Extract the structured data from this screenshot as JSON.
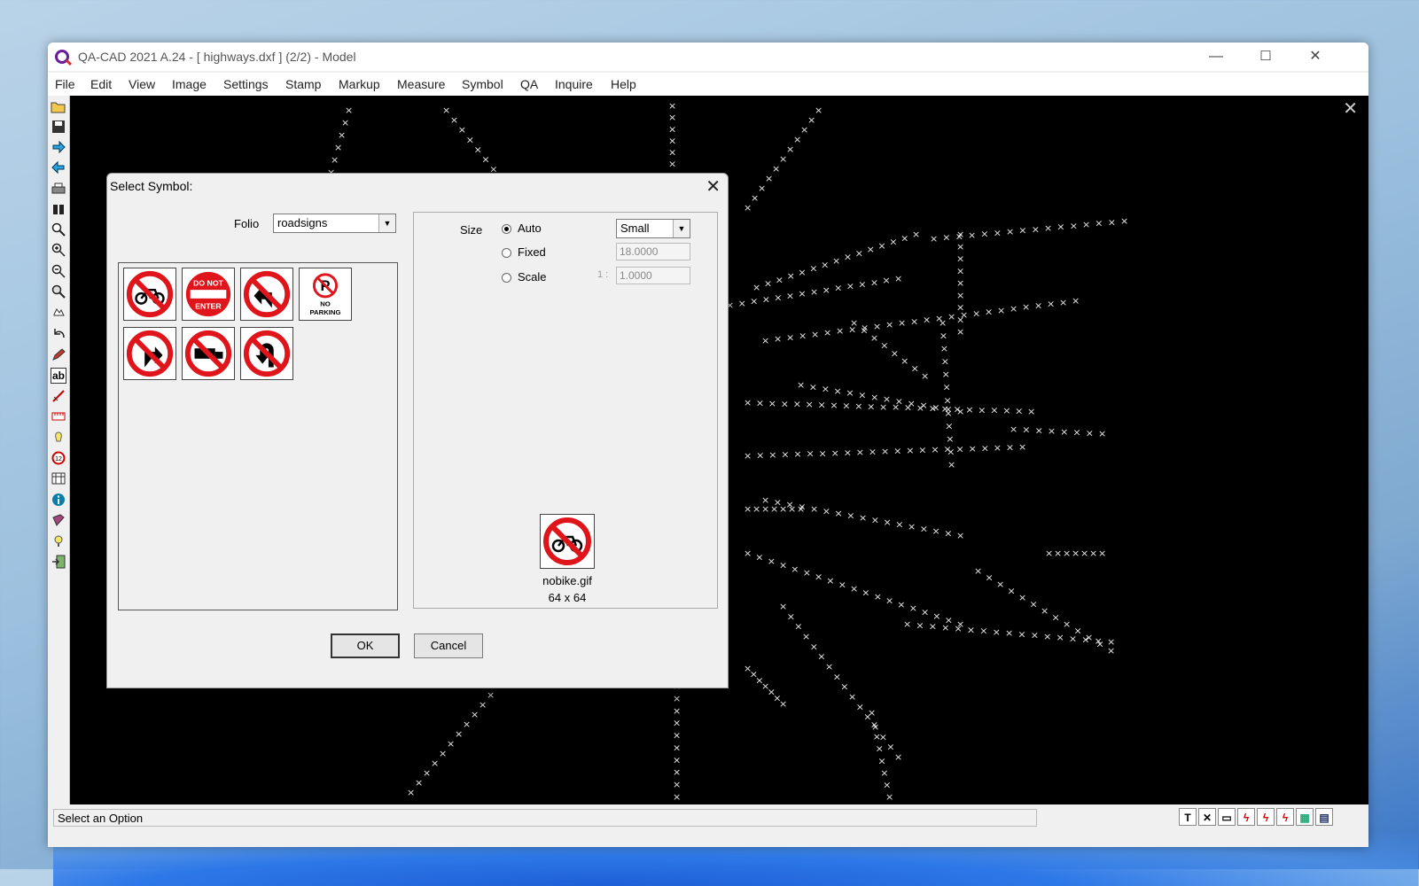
{
  "window": {
    "title": "QA-CAD 2021 A.24  -  [ highways.dxf ] (2/2)  -  Model",
    "minimize": "—",
    "maximize": "☐",
    "close": "✕"
  },
  "menu": [
    "File",
    "Edit",
    "View",
    "Image",
    "Settings",
    "Stamp",
    "Markup",
    "Measure",
    "Symbol",
    "QA",
    "Inquire",
    "Help"
  ],
  "toolbar_icons": [
    "open-icon",
    "save-icon",
    "forward-icon",
    "back-icon",
    "print-icon",
    "binoculars-icon",
    "zoom-icon",
    "zoom-in-icon",
    "zoom-out-icon",
    "zoom-window-icon",
    "pan-icon",
    "undo-icon",
    "pencil-icon",
    "text-icon",
    "measure-icon",
    "ruler-icon",
    "bulb-icon",
    "numbered-stamp-icon",
    "columns-icon",
    "info-icon",
    "book-icon",
    "help-icon",
    "exit-icon"
  ],
  "status": {
    "text": "Select an Option",
    "icons": [
      "T",
      "✕",
      "▭",
      "ϟ",
      "ϟ",
      "ϟ",
      "▦",
      "▤"
    ]
  },
  "dialog": {
    "title": "Select Symbol:",
    "close": "✕",
    "folio_label": "Folio",
    "folio_value": "roadsigns",
    "symbols": [
      "no-bike-sign",
      "do-not-enter-sign",
      "no-left-turn-sign",
      "no-parking-sign",
      "no-right-turn-sign",
      "no-trucks-sign",
      "no-u-turn-sign"
    ],
    "do_not_enter_text": [
      "DO NOT",
      "ENTER"
    ],
    "no_parking_text": [
      "P",
      "NO",
      "PARKING"
    ],
    "size_label": "Size",
    "options": {
      "auto": "Auto",
      "fixed": "Fixed",
      "scale": "Scale",
      "selected": "auto"
    },
    "size_select": "Small",
    "fixed_value": "18.0000",
    "scale_prefix": "1 :",
    "scale_value": "1.0000",
    "preview_name": "nobike.gif",
    "preview_size": "64 x 64",
    "ok": "OK",
    "cancel": "Cancel"
  },
  "colors": {
    "sign_red": "#e0151b",
    "canvas_bg": "#000000",
    "trace": "#e8e8e8"
  }
}
